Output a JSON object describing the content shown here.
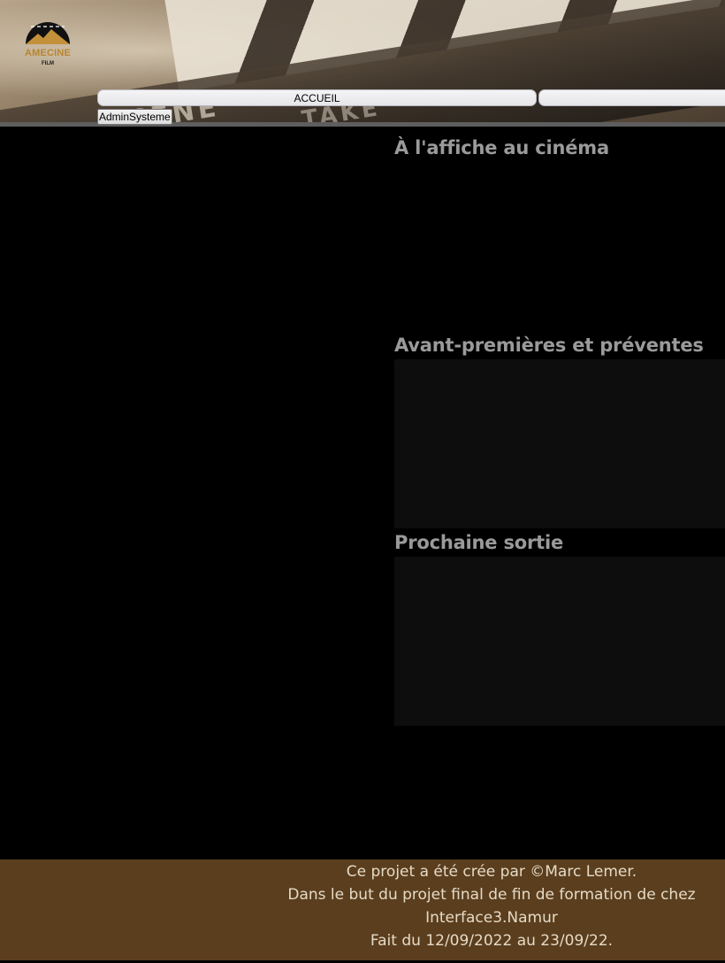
{
  "header": {
    "clapper_scene": "SCENE",
    "clapper_take": "TAKE",
    "logo": {
      "name": "AMECINE",
      "sub": "FILM",
      "color": "#b8862f"
    },
    "nav": {
      "accueil_label": "ACCUEIL",
      "second_label": ""
    },
    "admin_button_label": "AdminSysteme"
  },
  "main": {
    "sections": [
      {
        "title": "À l'affiche au cinéma"
      },
      {
        "title": "Avant-premières et préventes"
      },
      {
        "title": "Prochaine sortie"
      }
    ]
  },
  "footer": {
    "lines": [
      "Ce projet a été crée par ©Marc Lemer.",
      "Dans le but du projet final de fin de formation de chez Interface3.Namur",
      "Fait du 12/09/2022 au 23/09/22."
    ],
    "background": "#5a3e1e"
  }
}
